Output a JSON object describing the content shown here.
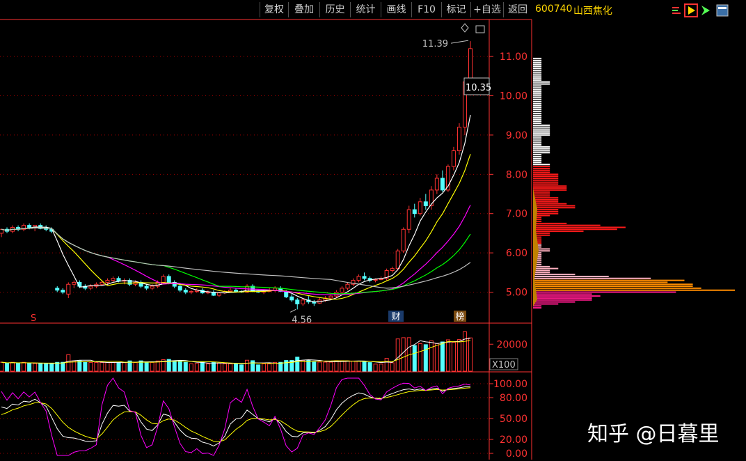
{
  "toolbar": {
    "buttons": [
      "复权",
      "叠加",
      "历史",
      "统计",
      "画线",
      "F10",
      "标记",
      "+自选",
      "返回"
    ]
  },
  "stock": {
    "code": "600740",
    "name": "山西焦化"
  },
  "watermark": "知乎 @日暮里",
  "colors": {
    "up": "#ff3232",
    "down": "#54ffff",
    "ma5": "#ffffff",
    "ma10": "#ffff00",
    "ma20": "#ff00ff",
    "ma30": "#00ff00",
    "ma60": "#c0c0c0",
    "grid": "#a00000",
    "axis": "#ff3232"
  },
  "chart_data": [
    {
      "type": "candlestick",
      "price_ticks": [
        "11.00",
        "10.00",
        "9.00",
        "8.00",
        "7.00",
        "6.00",
        "5.00"
      ],
      "ylim": [
        4.3,
        11.8
      ],
      "annotations": {
        "high_label": "11.39",
        "low_label": "4.56",
        "last_label": "10.35"
      },
      "markers": [
        "S",
        "财",
        "榜"
      ],
      "candles": [
        [
          6.5,
          6.6,
          6.4,
          6.6
        ],
        [
          6.6,
          6.65,
          6.5,
          6.55
        ],
        [
          6.55,
          6.7,
          6.5,
          6.65
        ],
        [
          6.65,
          6.7,
          6.55,
          6.6
        ],
        [
          6.6,
          6.75,
          6.55,
          6.7
        ],
        [
          6.7,
          6.75,
          6.6,
          6.65
        ],
        [
          6.65,
          6.7,
          6.55,
          6.7
        ],
        [
          6.7,
          6.75,
          6.6,
          6.62
        ],
        [
          6.62,
          6.7,
          6.55,
          6.6
        ],
        [
          6.6,
          6.65,
          6.5,
          6.55
        ],
        [
          5.1,
          5.15,
          5.0,
          5.05
        ],
        [
          5.05,
          5.1,
          4.95,
          5.0
        ],
        [
          4.95,
          5.25,
          4.85,
          5.2
        ],
        [
          5.2,
          5.3,
          5.1,
          5.25
        ],
        [
          5.25,
          5.3,
          5.1,
          5.15
        ],
        [
          5.15,
          5.2,
          5.05,
          5.1
        ],
        [
          5.1,
          5.2,
          5.05,
          5.15
        ],
        [
          5.15,
          5.25,
          5.1,
          5.2
        ],
        [
          5.2,
          5.3,
          5.15,
          5.25
        ],
        [
          5.25,
          5.35,
          5.2,
          5.3
        ],
        [
          5.3,
          5.4,
          5.25,
          5.35
        ],
        [
          5.35,
          5.4,
          5.25,
          5.28
        ],
        [
          5.28,
          5.35,
          5.2,
          5.3
        ],
        [
          5.3,
          5.35,
          5.15,
          5.2
        ],
        [
          5.2,
          5.3,
          5.15,
          5.25
        ],
        [
          5.25,
          5.3,
          5.1,
          5.15
        ],
        [
          5.15,
          5.2,
          5.05,
          5.1
        ],
        [
          5.1,
          5.2,
          5.05,
          5.15
        ],
        [
          5.15,
          5.3,
          5.1,
          5.25
        ],
        [
          5.25,
          5.45,
          5.2,
          5.4
        ],
        [
          5.4,
          5.45,
          5.2,
          5.25
        ],
        [
          5.25,
          5.3,
          5.1,
          5.15
        ],
        [
          5.15,
          5.2,
          5.0,
          5.05
        ],
        [
          5.05,
          5.1,
          4.95,
          5.0
        ],
        [
          5.0,
          5.05,
          4.95,
          5.02
        ],
        [
          5.02,
          5.1,
          4.98,
          5.05
        ],
        [
          5.05,
          5.1,
          4.95,
          4.98
        ],
        [
          4.98,
          5.05,
          4.95,
          5.0
        ],
        [
          5.0,
          5.05,
          4.9,
          4.92
        ],
        [
          4.92,
          5.0,
          4.88,
          4.98
        ],
        [
          4.98,
          5.05,
          4.95,
          5.02
        ],
        [
          5.02,
          5.1,
          5.0,
          5.05
        ],
        [
          5.05,
          5.1,
          5.0,
          5.02
        ],
        [
          5.02,
          5.05,
          4.98,
          5.0
        ],
        [
          5.0,
          5.2,
          4.98,
          5.15
        ],
        [
          5.15,
          5.2,
          5.0,
          5.02
        ],
        [
          5.02,
          5.05,
          4.98,
          5.0
        ],
        [
          5.0,
          5.05,
          4.95,
          5.02
        ],
        [
          5.02,
          5.1,
          5.0,
          5.05
        ],
        [
          5.05,
          5.15,
          5.0,
          5.1
        ],
        [
          5.1,
          5.15,
          5.0,
          5.02
        ],
        [
          5.02,
          5.05,
          4.85,
          4.88
        ],
        [
          4.88,
          4.95,
          4.75,
          4.8
        ],
        [
          4.8,
          4.85,
          4.56,
          4.7
        ],
        [
          4.7,
          4.85,
          4.65,
          4.8
        ],
        [
          4.8,
          4.9,
          4.7,
          4.75
        ],
        [
          4.75,
          4.8,
          4.65,
          4.72
        ],
        [
          4.72,
          4.85,
          4.7,
          4.8
        ],
        [
          4.8,
          4.9,
          4.75,
          4.85
        ],
        [
          4.85,
          4.95,
          4.8,
          4.9
        ],
        [
          4.9,
          5.05,
          4.85,
          5.0
        ],
        [
          5.0,
          5.15,
          4.95,
          5.1
        ],
        [
          5.1,
          5.25,
          5.05,
          5.2
        ],
        [
          5.2,
          5.35,
          5.15,
          5.3
        ],
        [
          5.3,
          5.45,
          5.25,
          5.4
        ],
        [
          5.4,
          5.5,
          5.3,
          5.35
        ],
        [
          5.35,
          5.4,
          5.25,
          5.3
        ],
        [
          5.3,
          5.35,
          5.25,
          5.32
        ],
        [
          5.32,
          5.4,
          5.3,
          5.35
        ],
        [
          5.35,
          5.6,
          5.3,
          5.55
        ],
        [
          5.55,
          5.65,
          5.5,
          5.6
        ],
        [
          5.6,
          6.1,
          5.55,
          6.05
        ],
        [
          6.05,
          6.65,
          6.0,
          6.6
        ],
        [
          6.6,
          7.2,
          6.5,
          7.1
        ],
        [
          7.1,
          7.25,
          6.9,
          7.0
        ],
        [
          7.0,
          7.4,
          6.95,
          7.3
        ],
        [
          7.3,
          7.5,
          7.1,
          7.2
        ],
        [
          7.2,
          7.7,
          7.1,
          7.6
        ],
        [
          7.6,
          8.0,
          7.5,
          7.9
        ],
        [
          7.9,
          8.1,
          7.55,
          7.6
        ],
        [
          7.6,
          8.25,
          7.55,
          8.2
        ],
        [
          8.2,
          8.7,
          8.1,
          8.6
        ],
        [
          8.6,
          9.3,
          8.5,
          9.2
        ],
        [
          9.2,
          10.4,
          9.0,
          10.35
        ],
        [
          10.35,
          11.39,
          10.3,
          11.2
        ]
      ],
      "volume": {
        "tick": "20000",
        "unit": "X100"
      },
      "kdj": {
        "ticks": [
          "100.00",
          "80.00",
          "50.00",
          "20.00",
          "0.00"
        ],
        "ylim": [
          -5,
          110
        ]
      }
    }
  ]
}
